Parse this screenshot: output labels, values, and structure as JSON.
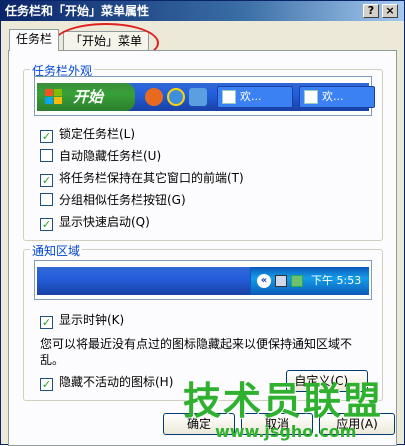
{
  "window": {
    "title": "任务栏和「开始」菜单属性",
    "help_btn": "?",
    "close_btn": "×"
  },
  "tabs": [
    {
      "label": "任务栏",
      "active": true
    },
    {
      "label": "「开始」菜单",
      "active": false
    }
  ],
  "appearance": {
    "legend": "任务栏外观",
    "preview": {
      "start_label": "开始",
      "task1": "欢...",
      "task2": "欢..."
    },
    "options": [
      {
        "label": "锁定任务栏(L)",
        "checked": true
      },
      {
        "label": "自动隐藏任务栏(U)",
        "checked": false
      },
      {
        "label": "将任务栏保持在其它窗口的前端(T)",
        "checked": true
      },
      {
        "label": "分组相似任务栏按钮(G)",
        "checked": false
      },
      {
        "label": "显示快速启动(Q)",
        "checked": true
      }
    ]
  },
  "notification": {
    "legend": "通知区域",
    "tray_time": "下午 5:53",
    "show_clock": {
      "label": "显示时钟(K)",
      "checked": true
    },
    "description": "您可以将最近没有点过的图标隐藏起来以便保持通知区域不乱。",
    "hide_inactive": {
      "label": "隐藏不活动的图标(H)",
      "checked": true
    },
    "customize_btn": "自定义(C)..."
  },
  "buttons": {
    "ok": "确定",
    "cancel": "取消",
    "apply": "应用(A)"
  },
  "watermark": {
    "title": "技术员联盟",
    "url": "www.jsgho.com"
  },
  "colors": {
    "title_bar": "#0a246a",
    "taskbar_blue": "#245edb",
    "start_green": "#37a037",
    "highlight_red": "#e02020"
  }
}
